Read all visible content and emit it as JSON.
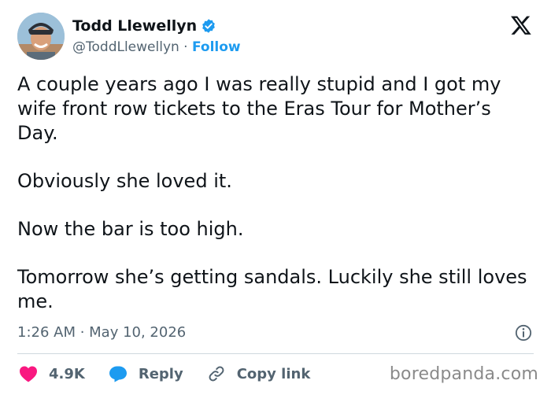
{
  "author": {
    "display_name": "Todd Llewellyn",
    "handle": "@ToddLlewellyn",
    "separator": " · ",
    "follow_label": "Follow",
    "verified_color": "#1d9bf0"
  },
  "brand_icon": "x-logo-icon",
  "tweet": {
    "paragraphs": [
      "A couple years ago I was really stupid and I got my wife front row tickets to the Eras Tour for Mother’s Day.",
      "Obviously she loved it.",
      "Now the bar is too high.",
      "Tomorrow she’s getting sandals. Luckily she still loves me."
    ],
    "timestamp": "1:26 AM · May 10, 2026"
  },
  "actions": {
    "likes_count": "4.9K",
    "reply_label": "Reply",
    "copy_link_label": "Copy link"
  },
  "colors": {
    "like": "#f91880",
    "reply": "#1d9bf0",
    "muted": "#536471"
  },
  "watermark": "boredpanda.com"
}
